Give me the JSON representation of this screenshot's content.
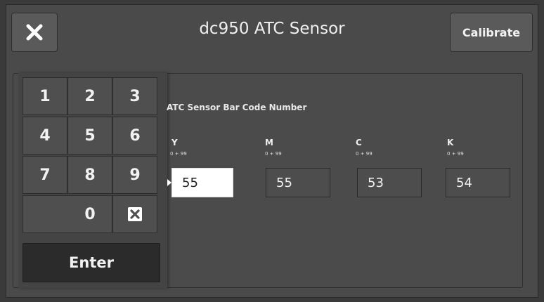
{
  "header": {
    "title": "dc950 ATC Sensor",
    "calibrate_label": "Calibrate"
  },
  "keypad": {
    "keys": [
      "1",
      "2",
      "3",
      "4",
      "5",
      "6",
      "7",
      "8",
      "9",
      "0"
    ],
    "backspace_icon": "clear-x-icon",
    "enter_label": "Enter"
  },
  "form": {
    "section_label": "ATC Sensor Bar Code Number",
    "fields": [
      {
        "label": "Y",
        "range": "0 + 99",
        "value": "55",
        "active": true
      },
      {
        "label": "M",
        "range": "0 + 99",
        "value": "55",
        "active": false
      },
      {
        "label": "C",
        "range": "0 + 99",
        "value": "53",
        "active": false
      },
      {
        "label": "K",
        "range": "0 + 99",
        "value": "54",
        "active": false
      }
    ]
  },
  "icons": {
    "close": "close-icon"
  },
  "colors": {
    "background": "#3a3a3a",
    "panel": "#4b4b4b",
    "enter_button": "#2b2b2b",
    "active_input": "#ffffff"
  }
}
